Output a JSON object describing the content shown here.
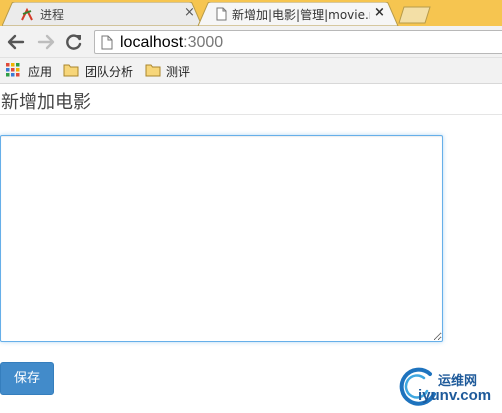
{
  "browser": {
    "tabs": [
      {
        "title": "进程",
        "icon": "process-app-icon"
      },
      {
        "title": "新增加|电影|管理|movie.n",
        "icon": "page-icon"
      }
    ],
    "close_glyph": "×",
    "address": {
      "host": "localhost",
      "port": ":3000"
    },
    "bookmarks": [
      {
        "label": "应用",
        "icon": "apps-grid-icon"
      },
      {
        "label": "团队分析",
        "icon": "folder-icon"
      },
      {
        "label": "测评",
        "icon": "folder-icon"
      }
    ],
    "tab_bar_color": "#f6c550"
  },
  "page": {
    "heading": "新增加电影",
    "content_value": "",
    "save_label": "保存",
    "accent": "#428bca"
  },
  "watermark": {
    "brand_cn": "运维网",
    "brand_en": "iyunv.com"
  }
}
